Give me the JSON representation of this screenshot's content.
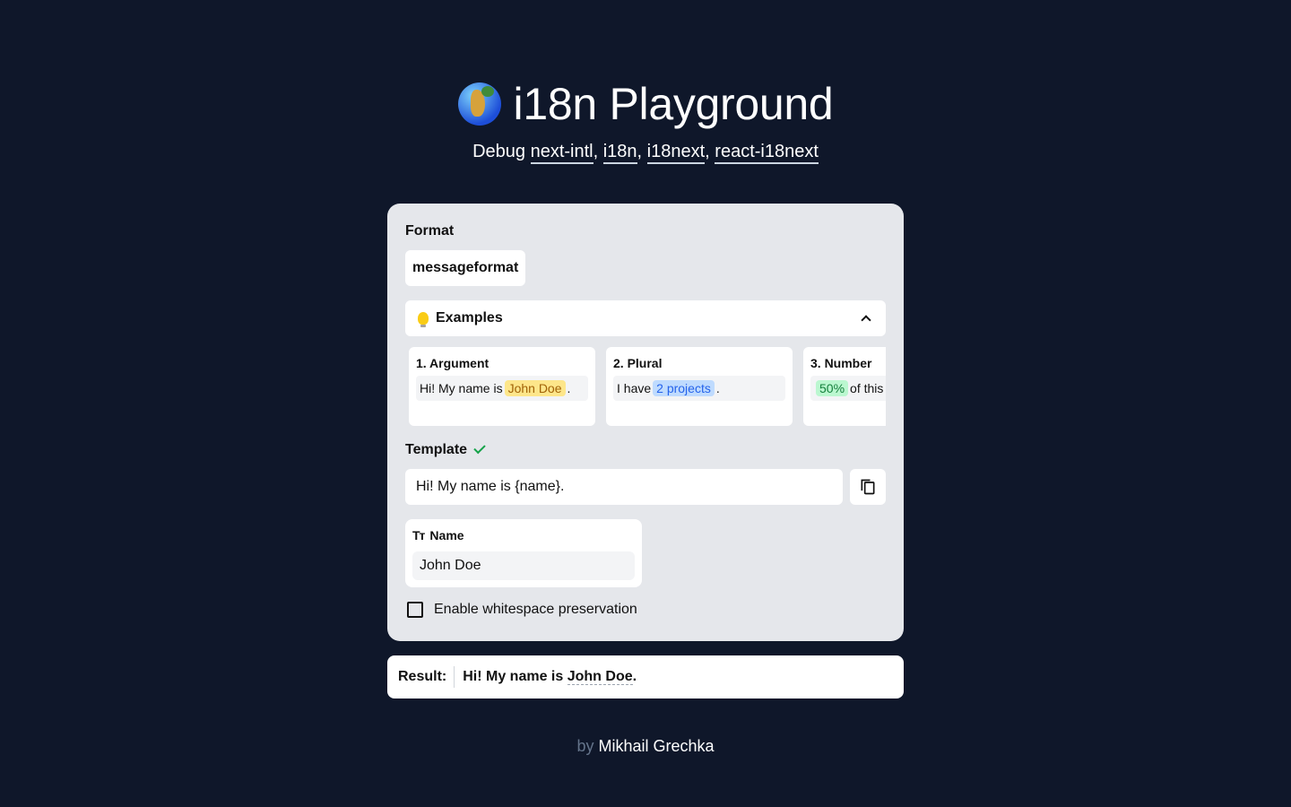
{
  "header": {
    "title": "i18n Playground",
    "subtitle_prefix": "Debug ",
    "libs": [
      "next-intl",
      "i18n",
      "i18next",
      "react-i18next"
    ],
    "separator": ", "
  },
  "format": {
    "label": "Format",
    "value": "messageformat"
  },
  "examples": {
    "label": "Examples",
    "items": [
      {
        "title": "1. Argument",
        "pre": "Hi! My name is ",
        "highlight": "John Doe",
        "post": ".",
        "color": "#fde68a"
      },
      {
        "title": "2. Plural",
        "pre": "I have ",
        "highlight": "2 projects",
        "post": ".",
        "color": "#bfdbfe"
      },
      {
        "title": "3. Number",
        "pre": "",
        "highlight": "50%",
        "post": " of this",
        "color": "#bbf7d0"
      }
    ]
  },
  "template": {
    "label": "Template",
    "value": "Hi! My name is {name}."
  },
  "argument": {
    "label": "Name",
    "value": "John Doe"
  },
  "whitespace": {
    "label": "Enable whitespace preservation",
    "checked": false
  },
  "result": {
    "label": "Result:",
    "pre": "Hi! My name is ",
    "value": "John Doe",
    "post": "."
  },
  "footer": {
    "by": "by",
    "author": "Mikhail Grechka"
  },
  "colors": {
    "background": "#0f172a",
    "card": "#e5e7eb",
    "success": "#16a34a"
  }
}
